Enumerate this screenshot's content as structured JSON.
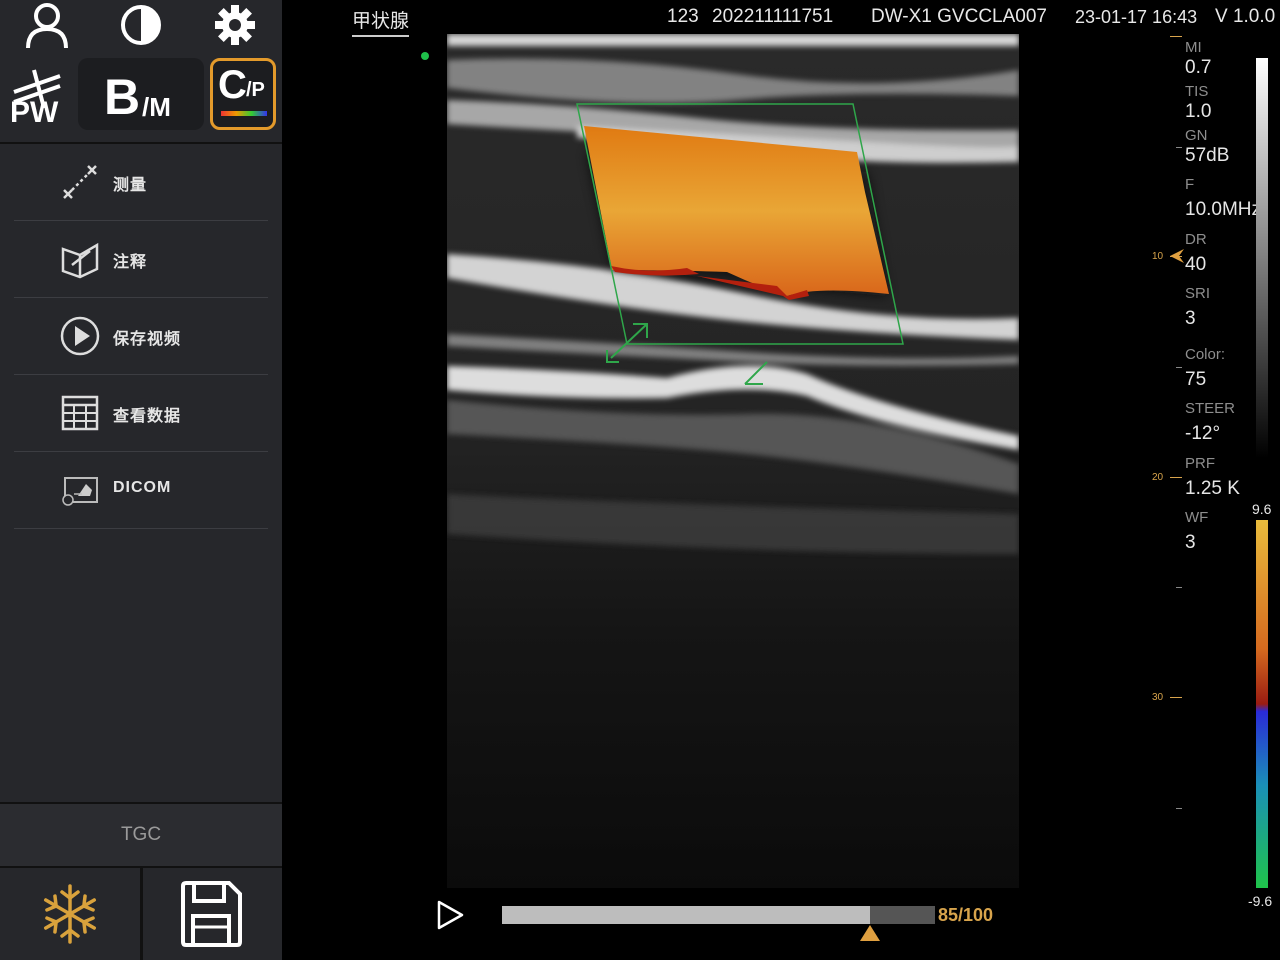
{
  "sidebar": {
    "top_icons": [
      "user-icon",
      "contrast-icon",
      "gear-icon"
    ],
    "modes": [
      {
        "label": "PW",
        "icon": "pw-mode-icon",
        "active": false
      },
      {
        "label_main": "B",
        "label_sub": "/M",
        "active": false
      },
      {
        "label_main": "C",
        "label_sub": "/P",
        "active": true
      }
    ],
    "menu": [
      {
        "label": "测量",
        "icon": "measure-icon"
      },
      {
        "label": "注释",
        "icon": "annotate-icon"
      },
      {
        "label": "保存视频",
        "icon": "play-circle-icon"
      },
      {
        "label": "查看数据",
        "icon": "table-icon"
      },
      {
        "label": "DICOM",
        "icon": "dicom-icon"
      }
    ],
    "tgc_label": "TGC",
    "bottom": [
      "snowflake-icon",
      "save-icon"
    ]
  },
  "header": {
    "probe": "甲状腺",
    "patient_id": "123",
    "exam_id": "202211111751",
    "device": "DW-X1 GVCCLA007",
    "datetime": "23-01-17 16:43",
    "version": "V 1.0.0"
  },
  "params": [
    {
      "label": "MI",
      "value": "0.7"
    },
    {
      "label": "TIS",
      "value": "1.0"
    },
    {
      "label": "GN",
      "value": "57dB"
    },
    {
      "label": "F",
      "value": "10.0MHz"
    },
    {
      "label": "DR",
      "value": "40"
    },
    {
      "label": "SRI",
      "value": "3"
    },
    {
      "label": "Color:",
      "value": "75"
    },
    {
      "label": "STEER",
      "value": "-12°"
    },
    {
      "label": "PRF",
      "value": "1.25 K"
    },
    {
      "label": "WF",
      "value": "3"
    }
  ],
  "depth_scale": {
    "labels": [
      "10",
      "20",
      "30"
    ]
  },
  "color_scale": {
    "max": "9.6",
    "min": "-9.6"
  },
  "playback": {
    "current": 85,
    "total": 100,
    "frame_text": "85/100"
  },
  "colors": {
    "accent": "#e39a2b",
    "sidebar_bg": "#26272b",
    "roi": "#2fa64a",
    "flow": "#e08a1c"
  }
}
